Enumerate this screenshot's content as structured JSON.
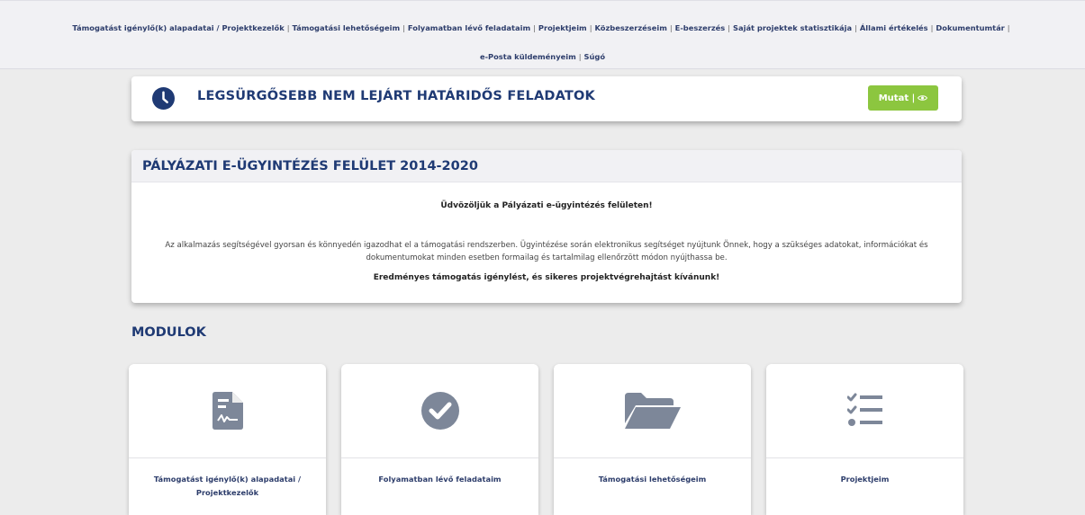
{
  "nav": {
    "row1": [
      "Támogatást igénylő(k) alapadatai / Projektkezelők",
      "Támogatási lehetőségeim",
      "Folyamatban lévő feladataim",
      "Projektjeim",
      "Közbeszerzéseim",
      "E-beszerzés",
      "Saját projektek statisztikája",
      "Állami értékelés",
      "Dokumentumtár"
    ],
    "row2": [
      "e-Posta küldeményeim",
      "Súgó"
    ],
    "separator": "|"
  },
  "urgent": {
    "icon": "clock-icon",
    "title": "LEGSÜRGŐSEBB NEM LEJÁRT HATÁRIDŐS FELADATOK",
    "button_label": "Mutat |",
    "button_icon": "eye-icon",
    "button_color": "#8cc63f"
  },
  "panel": {
    "title": "PÁLYÁZATI E-ÜGYINTÉZÉS FELÜLET 2014-2020",
    "welcome": "Üdvözöljük a Pályázati e-ügyintézés felületen!",
    "description": "Az alkalmazás segítségével gyorsan és könnyedén igazodhat el a támogatási rendszerben. Ügyintézése során elektronikus segítséget nyújtunk Önnek, hogy a szükséges adatokat, információkat és dokumentumokat minden esetben formailag és tartalmilag ellenőrzött módon nyújthassa be.",
    "wish": "Eredményes támogatás igénylést, és sikeres projektvégrehajtást kívánunk!"
  },
  "modules": {
    "title": "MODULOK",
    "cards": [
      {
        "label": "Támogatást igénylő(k) alapadatai / Projektkezelők",
        "icon": "document-signature-icon"
      },
      {
        "label": "Folyamatban lévő feladataim",
        "icon": "check-circle-icon"
      },
      {
        "label": "Támogatási lehetőségeim",
        "icon": "folder-open-icon"
      },
      {
        "label": "Projektjeim",
        "icon": "checklist-icon"
      }
    ]
  },
  "colors": {
    "brand_blue": "#1f3a74",
    "icon_gray": "#7d8799",
    "page_bg": "#ececec"
  }
}
